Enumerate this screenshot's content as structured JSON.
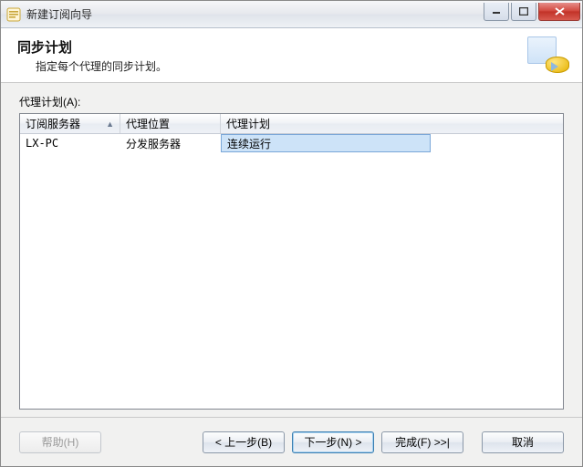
{
  "window": {
    "title": "新建订阅向导"
  },
  "header": {
    "title": "同步计划",
    "description": "指定每个代理的同步计划。"
  },
  "body": {
    "plan_label": "代理计划(A):"
  },
  "grid": {
    "columns": {
      "subscriber": "订阅服务器",
      "location": "代理位置",
      "plan": "代理计划"
    },
    "rows": [
      {
        "subscriber": "LX-PC",
        "location": "分发服务器",
        "plan": "连续运行"
      }
    ]
  },
  "footer": {
    "help": "帮助(H)",
    "back": "< 上一步(B)",
    "next": "下一步(N) >",
    "finish": "完成(F) >>|",
    "cancel": "取消"
  }
}
